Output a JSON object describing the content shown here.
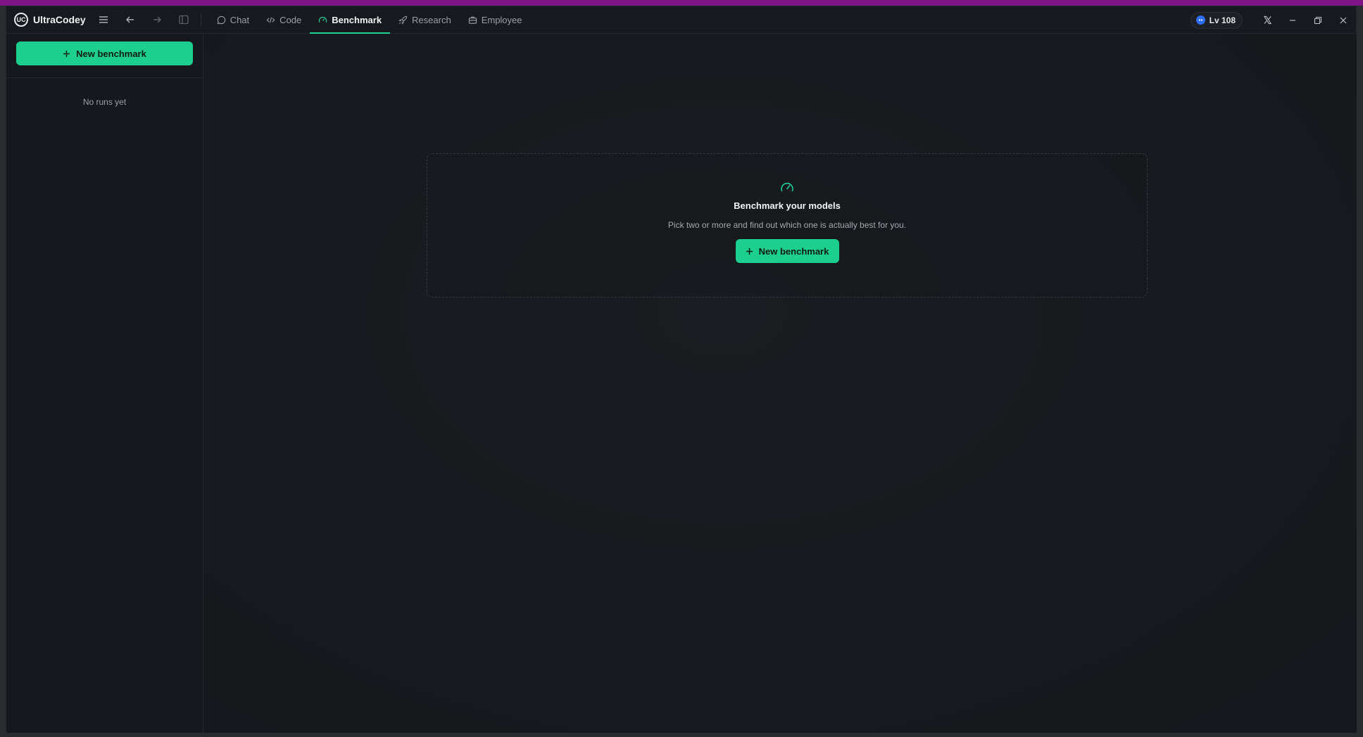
{
  "app": {
    "name": "UltraCodey",
    "logo_text": "UC"
  },
  "tabs": [
    {
      "label": "Chat",
      "icon": "chat-bubble-icon",
      "active": false
    },
    {
      "label": "Code",
      "icon": "code-icon",
      "active": false
    },
    {
      "label": "Benchmark",
      "icon": "gauge-icon",
      "active": true
    },
    {
      "label": "Research",
      "icon": "rocket-icon",
      "active": false
    },
    {
      "label": "Employee",
      "icon": "briefcase-icon",
      "active": false
    }
  ],
  "level": {
    "label": "Lv 108"
  },
  "sidebar": {
    "new_button_label": "New benchmark",
    "empty_text": "No runs yet"
  },
  "main": {
    "empty_title": "Benchmark your models",
    "empty_subtitle": "Pick two or more and find out which one is actually best for you.",
    "new_button_label": "New benchmark"
  },
  "colors": {
    "accent": "#1ccf8f",
    "background": "#16191d",
    "window_frame_top": "#7d1585",
    "level_badge": "#2e6df2"
  }
}
